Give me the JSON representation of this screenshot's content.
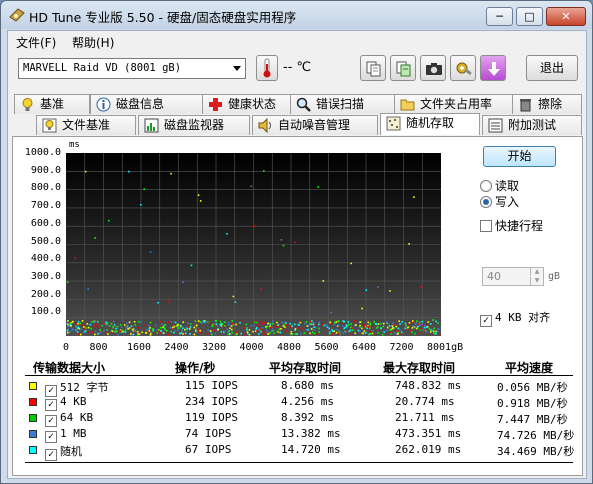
{
  "window": {
    "title": "HD Tune 专业版 5.50 - 硬盘/固态硬盘实用程序",
    "minimize": "─",
    "maximize": "□",
    "close": "✕"
  },
  "menu": [
    "文件(F)",
    "帮助(H)"
  ],
  "toolbar": {
    "drive": "MARVELL Raid VD (8001 gB)",
    "temperature": "-- ℃",
    "exit_label": "退出",
    "icons": [
      "copy-icon",
      "copy-green-icon",
      "camera-icon",
      "tools-icon",
      "download-icon"
    ]
  },
  "tabs_row1": [
    {
      "label": "基准",
      "icon": "bulb-icon"
    },
    {
      "label": "磁盘信息",
      "icon": "info-icon"
    },
    {
      "label": "健康状态",
      "icon": "health-plus-icon"
    },
    {
      "label": "错误扫描",
      "icon": "magnifier-icon"
    },
    {
      "label": "文件夹占用率",
      "icon": "folder-icon"
    },
    {
      "label": "擦除",
      "icon": "trash-icon"
    }
  ],
  "tabs_row2": [
    {
      "label": "文件基准",
      "icon": "bulb-file-icon"
    },
    {
      "label": "磁盘监视器",
      "icon": "monitor-chart-icon"
    },
    {
      "label": "自动噪音管理",
      "icon": "speaker-icon"
    },
    {
      "label": "随机存取",
      "icon": "random-access-icon",
      "active": true
    },
    {
      "label": "附加测试",
      "icon": "extra-tests-icon"
    }
  ],
  "chart_data": {
    "type": "scatter",
    "y_unit": "ms",
    "x_unit": "gB",
    "yticks": [
      "1000.0",
      "900.0",
      "800.0",
      "700.0",
      "600.0",
      "500.0",
      "400.0",
      "300.0",
      "200.0",
      "100.0"
    ],
    "xticks": [
      "0",
      "800",
      "1600",
      "2400",
      "3200",
      "4000",
      "4800",
      "5600",
      "6400",
      "7200",
      "8001gB"
    ],
    "xlim": [
      0,
      8001
    ],
    "ylim": [
      0,
      1000
    ],
    "grid": true,
    "series_colors": [
      "#ffff00",
      "#ff0000",
      "#00ff00",
      "#3a7bd5",
      "#00ffff"
    ]
  },
  "controls": {
    "start_label": "开始",
    "read_label": "读取",
    "write_label": "写入",
    "read_selected": false,
    "write_selected": true,
    "short_stroke_label": "快捷行程",
    "short_stroke_checked": false,
    "short_stroke_value": "40",
    "short_stroke_unit": "gB",
    "align_label": "4 KB 对齐",
    "align_checked": true
  },
  "results": {
    "headers": [
      "传输数据大小",
      "操作/秒",
      "平均存取时间",
      "最大存取时间",
      "平均速度"
    ],
    "rows": [
      {
        "size": "512 字节",
        "color": "#ffff00",
        "ops": "115 IOPS",
        "avg": "8.680 ms",
        "max": "748.832 ms",
        "speed": "0.056 MB/秒"
      },
      {
        "size": "4 KB",
        "color": "#ff0000",
        "ops": "234 IOPS",
        "avg": "4.256 ms",
        "max": "20.774 ms",
        "speed": "0.918 MB/秒"
      },
      {
        "size": "64 KB",
        "color": "#00cc00",
        "ops": "119 IOPS",
        "avg": "8.392 ms",
        "max": "21.711 ms",
        "speed": "7.447 MB/秒"
      },
      {
        "size": "1 MB",
        "color": "#3a7bd5",
        "ops": "74 IOPS",
        "avg": "13.382 ms",
        "max": "473.351 ms",
        "speed": "74.726 MB/秒"
      },
      {
        "size": "随机",
        "color": "#00ffff",
        "ops": "67 IOPS",
        "avg": "14.720 ms",
        "max": "262.019 ms",
        "speed": "34.469 MB/秒"
      }
    ]
  }
}
